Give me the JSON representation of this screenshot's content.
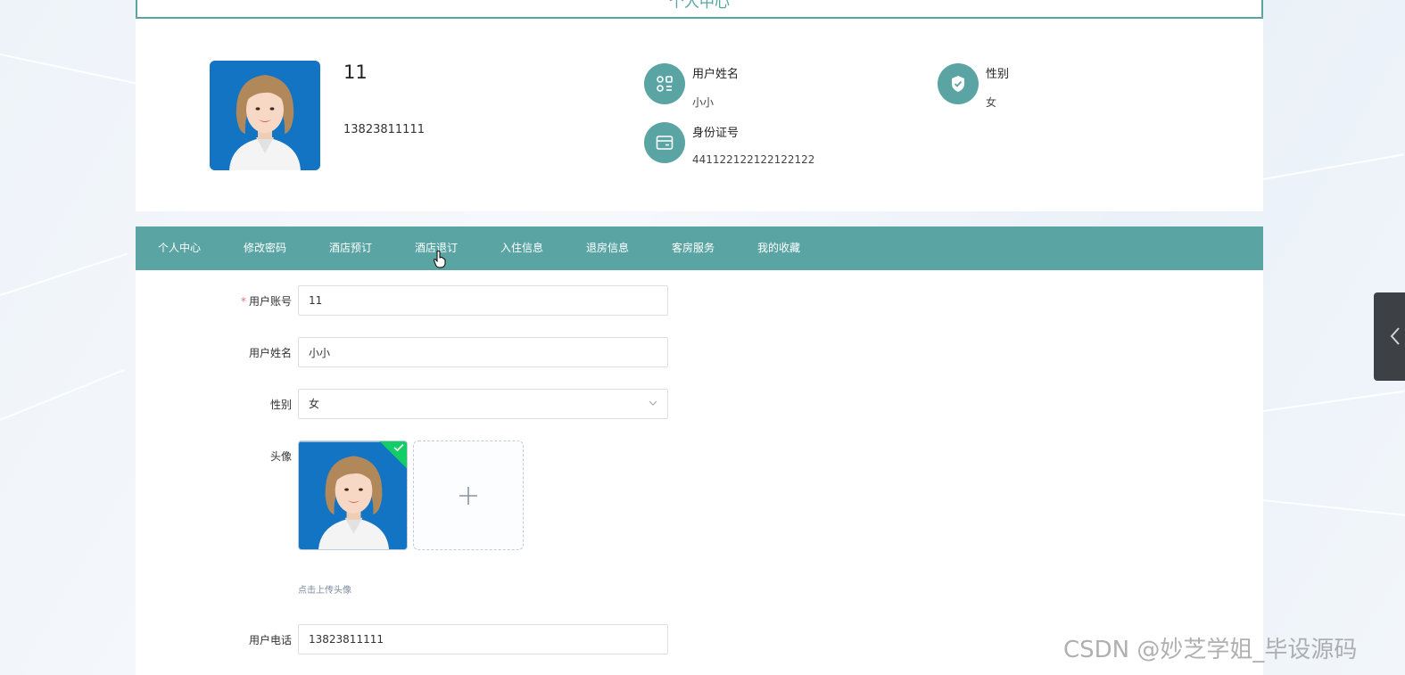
{
  "page": {
    "title": "个人中心"
  },
  "profile": {
    "name": "11",
    "phone": "13823811111",
    "fields": [
      {
        "label": "用户姓名",
        "value": "小小",
        "icon": "user-grid-icon"
      },
      {
        "label": "性别",
        "value": "女",
        "icon": "shield-check-icon"
      },
      {
        "label": "身份证号",
        "value": "441122122122122122",
        "icon": "id-card-icon"
      }
    ]
  },
  "nav": {
    "items": [
      "个人中心",
      "修改密码",
      "酒店预订",
      "酒店退订",
      "入住信息",
      "退房信息",
      "客房服务",
      "我的收藏"
    ],
    "hovered": "酒店退订"
  },
  "form": {
    "account": {
      "label": "用户账号",
      "required_mark": "*",
      "value": "11"
    },
    "name": {
      "label": "用户姓名",
      "value": "小小"
    },
    "gender": {
      "label": "性别",
      "value": "女"
    },
    "avatar": {
      "label": "头像",
      "hint": "点击上传头像"
    },
    "phone": {
      "label": "用户电话",
      "value": "13823811111"
    }
  },
  "watermark": "CSDN @妙芝学姐_毕设源码",
  "colors": {
    "accent": "#5aa4a4",
    "required": "#f56c6c",
    "success": "#13ce66"
  }
}
